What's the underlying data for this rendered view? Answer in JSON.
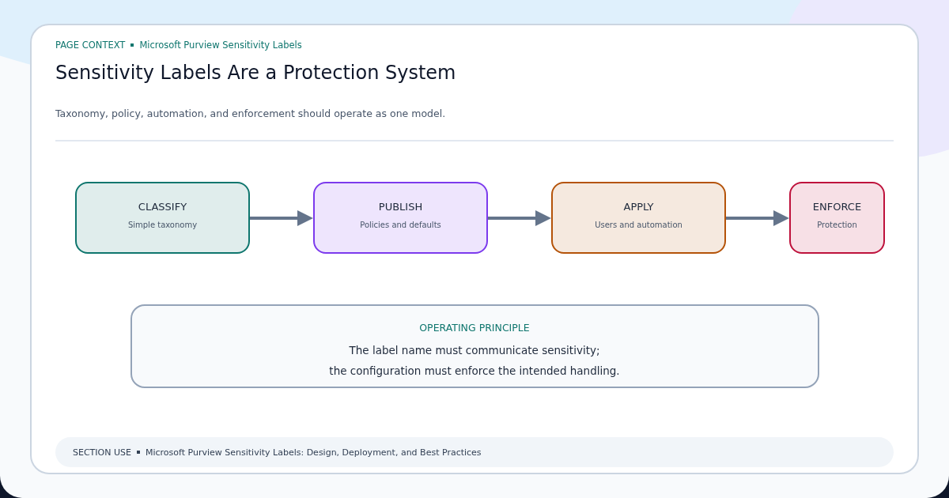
{
  "context": {
    "label": "PAGE CONTEXT",
    "value": "Microsoft Purview Sensitivity Labels"
  },
  "title": "Sensitivity Labels Are a Protection System",
  "subtitle": "Taxonomy, policy, automation, and enforcement should operate as one model.",
  "flow": [
    {
      "title": "CLASSIFY",
      "caption": "Simple taxonomy",
      "color": "#0f766e",
      "kind": "wide"
    },
    {
      "title": "PUBLISH",
      "caption": "Policies and defaults",
      "color": "#7c3aed",
      "kind": "wide"
    },
    {
      "title": "APPLY",
      "caption": "Users and automation",
      "color": "#b45309",
      "kind": "wide"
    },
    {
      "title": "ENFORCE",
      "caption": "Protection",
      "color": "#be123c",
      "kind": "narrow"
    }
  ],
  "principle": {
    "heading": "OPERATING PRINCIPLE",
    "lines": [
      "The label name must communicate sensitivity;",
      "the configuration must enforce the intended handling."
    ]
  },
  "footer": {
    "label": "SECTION USE",
    "value": "Microsoft Purview Sensitivity Labels: Design, Deployment, and Best Practices"
  }
}
